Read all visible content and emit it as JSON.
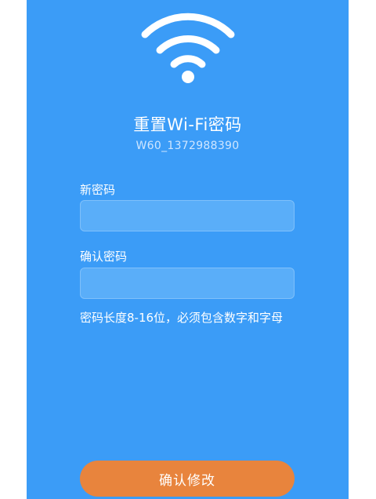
{
  "header": {
    "icon": "wifi-icon",
    "title": "重置Wi-Fi密码",
    "device_id": "W60_1372988390"
  },
  "form": {
    "new_password": {
      "label": "新密码",
      "value": "",
      "placeholder": ""
    },
    "confirm_password": {
      "label": "确认密码",
      "value": "",
      "placeholder": ""
    },
    "hint": "密码长度8-16位，必须包含数字和字母",
    "submit_label": "确认修改"
  },
  "colors": {
    "background": "#3b9cf7",
    "input_fill": "#5aaef9",
    "button": "#e8843d",
    "text": "#ffffff"
  }
}
